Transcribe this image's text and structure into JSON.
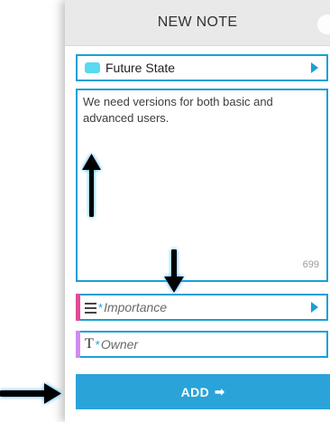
{
  "header": {
    "title": "NEW NOTE"
  },
  "category_field": {
    "value": "Future State",
    "chip_color": "#59d9f2",
    "chevron_icon": "chevron-right-icon"
  },
  "note": {
    "text": "We need versions for both basic and advanced users.",
    "remaining_count": "699"
  },
  "importance_field": {
    "icon": "list-icon",
    "required_mark": "*",
    "placeholder": "Importance",
    "accent_color": "#e4489a"
  },
  "owner_field": {
    "icon": "text-icon",
    "icon_text": "T",
    "required_mark": "*",
    "placeholder": "Owner",
    "accent_color": "#cf8bf0"
  },
  "actions": {
    "add_label": "ADD",
    "add_icon": "arrow-right-icon",
    "add_icon_text": "➡"
  },
  "annotations": {
    "arrow_color": "#000000",
    "arrow_glow_color": "#21a7ff"
  }
}
